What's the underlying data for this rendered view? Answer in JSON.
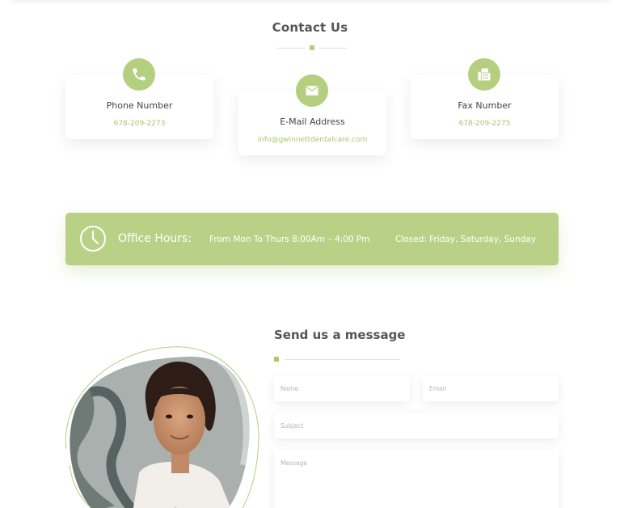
{
  "contact": {
    "title": "Contact Us",
    "cards": [
      {
        "icon": "phone-icon",
        "label": "Phone Number",
        "value": "678-209-2273"
      },
      {
        "icon": "mail-icon",
        "label": "E-Mail Address",
        "value": "info@gwinnettdentalcare.com"
      },
      {
        "icon": "fax-icon",
        "label": "Fax Number",
        "value": "678-209-2275"
      }
    ]
  },
  "hours": {
    "icon": "clock-icon",
    "title": "Office Hours:",
    "open": "From Mon To Thurs 8:00Am – 4:00 Pm",
    "closed": "Closed: Friday, Saturday, Sunday"
  },
  "message": {
    "title": "Send us a message",
    "name_placeholder": "Name",
    "email_placeholder": "Email",
    "subject_placeholder": "Subject",
    "message_placeholder": "Message"
  },
  "colors": {
    "accent": "#b5cf80",
    "accent_text": "#a9c96e",
    "bar": "#b9d187"
  }
}
